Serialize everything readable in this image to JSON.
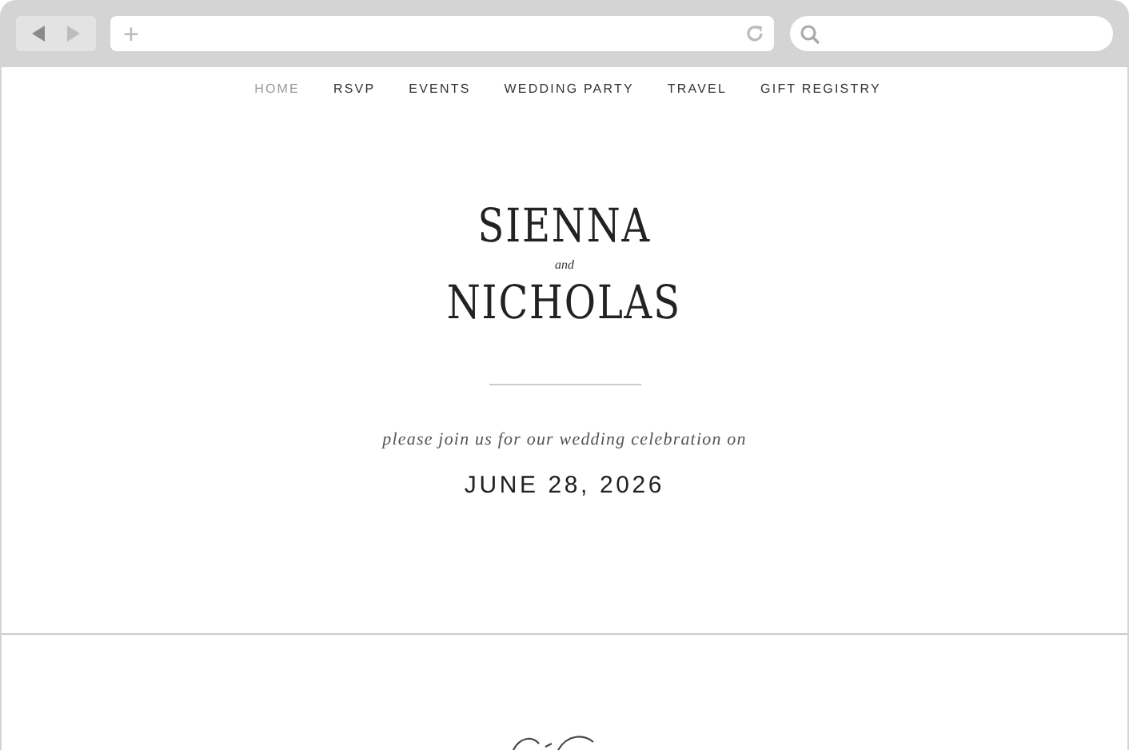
{
  "browser": {
    "address_icon": "+"
  },
  "nav": [
    {
      "label": "HOME",
      "selected": true
    },
    {
      "label": "RSVP",
      "selected": false
    },
    {
      "label": "EVENTS",
      "selected": false
    },
    {
      "label": "WEDDING PARTY",
      "selected": false
    },
    {
      "label": "TRAVEL",
      "selected": false
    },
    {
      "label": "GIFT REGISTRY",
      "selected": false
    }
  ],
  "hero": {
    "name_1": "SIENNA",
    "joiner": "and",
    "name_2": "NICHOLAS",
    "invitation": "please join us for our wedding celebration on",
    "date": "JUNE 28, 2026"
  }
}
